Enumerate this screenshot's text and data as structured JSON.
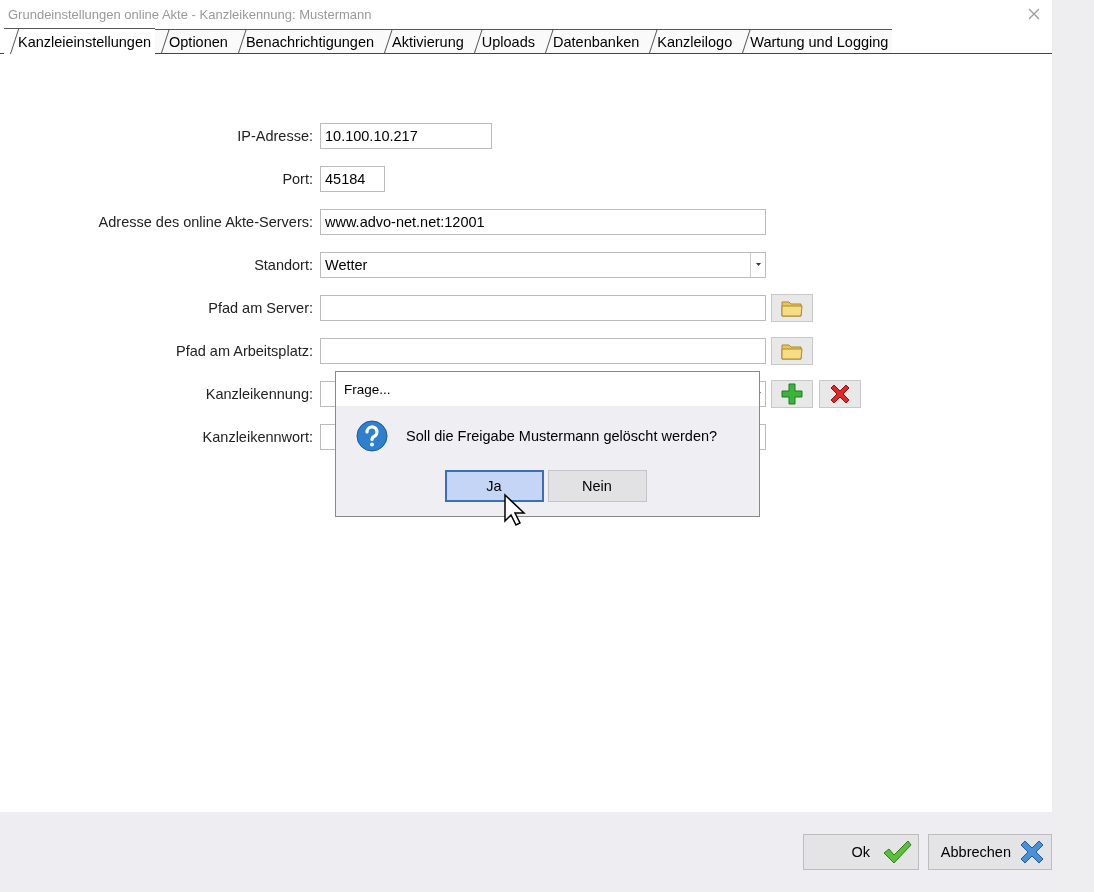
{
  "window": {
    "title": "Grundeinstellungen online Akte - Kanzleikennung: Mustermann"
  },
  "tabs": [
    {
      "label": "Kanzleieinstellungen",
      "selected": true
    },
    {
      "label": "Optionen",
      "selected": false
    },
    {
      "label": "Benachrichtigungen",
      "selected": false
    },
    {
      "label": "Aktivierung",
      "selected": false
    },
    {
      "label": "Uploads",
      "selected": false
    },
    {
      "label": "Datenbanken",
      "selected": false
    },
    {
      "label": "Kanzleilogo",
      "selected": false
    },
    {
      "label": "Wartung und Logging",
      "selected": false
    }
  ],
  "form": [
    {
      "label": "IP-Adresse:",
      "kind": "short",
      "value": "10.100.10.217"
    },
    {
      "label": "Port:",
      "kind": "tiny",
      "value": "45184"
    },
    {
      "label": "Adresse des online Akte-Servers:",
      "kind": "wide",
      "value": "www.advo-net.net:12001"
    },
    {
      "label": "Standort:",
      "kind": "combo",
      "value": "Wetter"
    },
    {
      "label": "Pfad am Server:",
      "kind": "path"
    },
    {
      "label": "Pfad am Arbeitsplatz:",
      "kind": "path"
    },
    {
      "label": "Kanzleikennung:",
      "kind": "combo-edit"
    },
    {
      "label": "Kanzleikennwort:",
      "kind": "wide"
    }
  ],
  "dialog": {
    "title": "Frage...",
    "message": "Soll die Freigabe Mustermann gelöscht werden?",
    "buttons": [
      {
        "label": "Ja",
        "selected": true
      },
      {
        "label": "Nein",
        "selected": false
      }
    ]
  },
  "buttons": [
    {
      "label": "Ok",
      "kind": "ok"
    },
    {
      "label": "Abbrechen",
      "kind": "cancel"
    }
  ]
}
